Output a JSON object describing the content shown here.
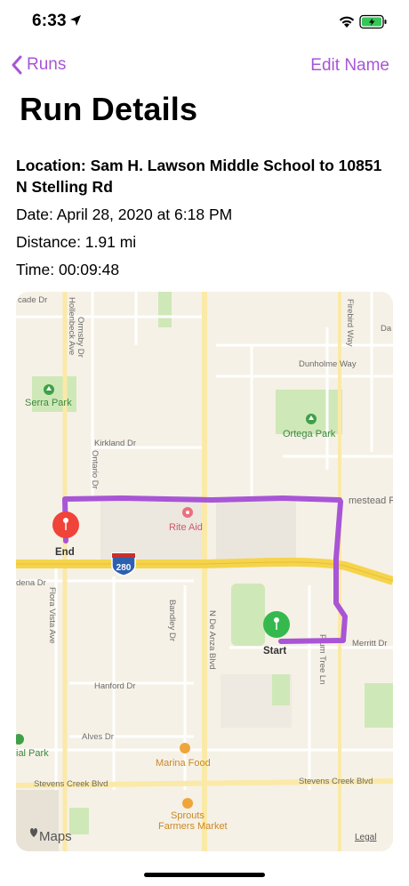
{
  "status_bar": {
    "time": "6:33"
  },
  "nav": {
    "back_label": "Runs",
    "edit_label": "Edit Name"
  },
  "title": "Run Details",
  "details": {
    "location": "Location: Sam H. Lawson Middle School to 10851 N Stelling Rd",
    "date": "Date: April 28, 2020 at 6:18 PM",
    "distance": "Distance: 1.91 mi",
    "time": "Time: 00:09:48"
  },
  "map": {
    "streets": {
      "cade": "cade Dr",
      "hollenbeck": "Hollenbeck Ave",
      "ormsby": "Ormsby Dr",
      "firebird": "Firebird Way",
      "da": "Da",
      "dunholme": "Dunholme Way",
      "kirkland": "Kirkland Dr",
      "ontario": "Ontario Dr",
      "homestead": "mestead R",
      "adena": "dena Dr",
      "flora": "Flora Vista Ave",
      "bandley": "Bandley Dr",
      "de_anza": "N De Anza Blvd",
      "plum_tree": "Plum Tree Ln",
      "merritt": "Merritt Dr",
      "hanford": "Hanford Dr",
      "alves": "Alves Dr",
      "stevens_left": "Stevens Creek Blvd",
      "stevens_right": "Stevens Creek Blvd"
    },
    "places": {
      "serra_park": "Serra Park",
      "ortega_park": "Ortega Park",
      "rite_aid": "Rite Aid",
      "marina_food": "Marina Food",
      "sprouts_1": "Sprouts",
      "sprouts_2": "Farmers Market",
      "memorial_park": "ial Park"
    },
    "highway": "280",
    "start_label": "Start",
    "end_label": "End",
    "maps_logo": "Maps",
    "legal": "Legal",
    "colors": {
      "route": "#a855d6",
      "start_pin": "#35b94e",
      "end_pin": "#f04339",
      "highway": "#f5d44c",
      "park": "#cfe8b8"
    }
  }
}
